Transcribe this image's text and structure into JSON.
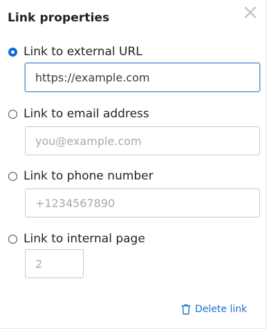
{
  "dialog": {
    "title": "Link properties",
    "close_icon": "close-icon"
  },
  "options": [
    {
      "label": "Link to external URL",
      "selected": true,
      "field": {
        "value": "https://example.com",
        "placeholder": ""
      }
    },
    {
      "label": "Link to email address",
      "selected": false,
      "field": {
        "value": "",
        "placeholder": "you@example.com"
      }
    },
    {
      "label": "Link to phone number",
      "selected": false,
      "field": {
        "value": "",
        "placeholder": "+1234567890"
      }
    },
    {
      "label": "Link to internal page",
      "selected": false,
      "field": {
        "value": "",
        "placeholder": "2"
      }
    }
  ],
  "footer": {
    "delete_label": "Delete link",
    "delete_icon": "trash-icon"
  },
  "colors": {
    "accent": "#1a73c8",
    "radio_selected": "#0a6cd6",
    "field_focus_border": "#5b9bd5"
  }
}
